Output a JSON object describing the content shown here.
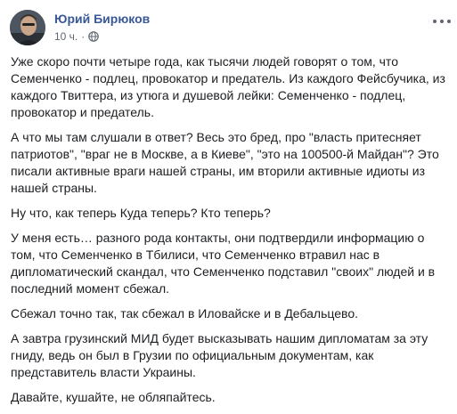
{
  "post": {
    "author": "Юрий Бирюков",
    "time": "10 ч.",
    "separator": "·",
    "privacy_icon": "globe-icon",
    "more_icon": "more-options-icon",
    "paragraphs": [
      "Уже скоро почти четыре года, как тысячи людей говорят о том, что Семенченко - подлец, провокатор и предатель. Из каждого Фейсбучика, из каждого Твиттера, из утюга и душевой лейки: Семенченко - подлец, провокатор и предатель.",
      "А что мы там слушали в ответ? Весь это бред, про \"власть притесняет патриотов\", \"враг не в Москве, а в Киеве\", \"это на 100500-й Майдан\"? Это писали активные враги нашей страны, им вторили активные идиоты из нашей страны.",
      "Ну что, как теперь Куда теперь? Кто теперь?",
      "У меня есть… разного рода контакты, они подтвердили информацию о том, что Семенченко в Тбилиси, что Семенченко втравил нас в дипломатический скандал, что Семенченко подставил \"своих\" людей и в последний момент сбежал.",
      "Сбежал точно так, так сбежал в Иловайске и в Дебальцево.",
      "А завтра грузинский МИД будет высказывать нашим дипломатам за эту гниду, ведь он был в Грузии по официальным документам, как представитель власти Украины.",
      "Давайте, кушайте, не обляпайтесь."
    ]
  },
  "colors": {
    "author": "#385898",
    "meta": "#606770",
    "text": "#1c1e21"
  }
}
